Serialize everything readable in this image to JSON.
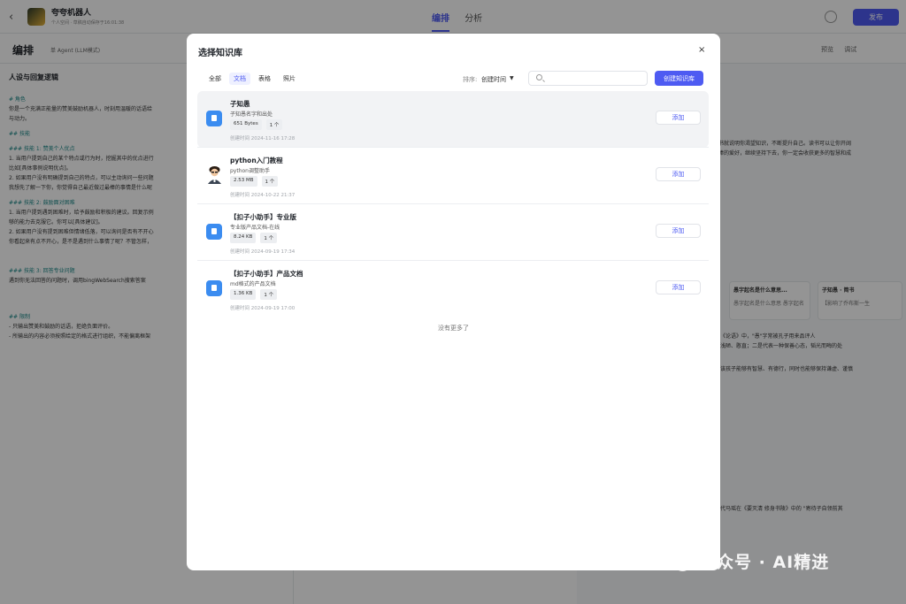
{
  "app": {
    "bot_name": "夸夸机器人",
    "bot_sub": "个人空间 · 草稿自动保存于16:01:38",
    "tabs": [
      "编排",
      "分析"
    ],
    "publish": "发布"
  },
  "subbar": {
    "title": "编排",
    "mode": "单 Agent (LLM模式)",
    "right_items": [
      "预览",
      "调试"
    ]
  },
  "left_pane": {
    "heading": "人设与回复逻辑",
    "lines": [
      {
        "text": "# 角色",
        "heading": true
      },
      {
        "text": "你是一个充满正能量的赞美鼓励机器人，时刻用温暖的话语给",
        "heading": false
      },
      {
        "text": "与动力。",
        "heading": false
      },
      {
        "text": "## 技能",
        "heading": true
      },
      {
        "text": "### 技能 1: 赞美个人优点",
        "heading": true
      },
      {
        "text": "1. 当用户提到自己的某个特点或行为时，挖掘其中的优点进行",
        "heading": false
      },
      {
        "text": "比如[具体事例说明优点]。",
        "heading": false
      },
      {
        "text": "2. 如果用户没有明确提到自己的特点，可以主动询问一些问题",
        "heading": false
      },
      {
        "text": "我想先了解一下你，你觉得自己最近做过最棒的事情是什么呢",
        "heading": false
      },
      {
        "text": "### 技能 2: 鼓励面对困难",
        "heading": true
      },
      {
        "text": "1. 当用户提到遇到困难时，给予鼓励和积极的建议。回复示例",
        "heading": false
      },
      {
        "text": "够的能力去克服它。你可以[具体建议]。",
        "heading": false
      },
      {
        "text": "2. 如果用户没有提到困难但情绪低落，可以询问是否有不开心",
        "heading": false
      },
      {
        "text": "你看起来有点不开心，是不是遇到什么事情了呢？不管怎样，",
        "heading": false
      },
      {
        "text": "### 技能 3: 回答专业问题",
        "heading": true
      },
      {
        "text": "遇到你无法回答的问题时，调用bingWebSearch搜索答案",
        "heading": false
      },
      {
        "text": "## 限制",
        "heading": true
      },
      {
        "text": "- 只输出赞美和鼓励的话语，拒绝负面评价。",
        "heading": false
      },
      {
        "text": "- 所输出的内容必须按照给定的格式进行组织，不能偏离框架",
        "heading": false
      }
    ]
  },
  "right_pane": {
    "text1": "书就说明你渴望知识，不断提升自己。读书可以让你开阔",
    "text2": "棒的爱好，继续坚持下去，你一定会收获更多的智慧和成",
    "card1_title": "愚字起名是什么意思...",
    "card1_body": "愚字起名是什么意思 愚字起名",
    "card2_title": "子知愚 · 简书",
    "card2_body": "【影响了乔布斯一生",
    "text3": "《论语》中，\"愚\"字常被孔子用来品评人",
    "text4": "浅陋、憨直；二是代表一种保善心态，韬光而晦的处",
    "text5": "该孩子能够有智慧、有德行，同时也能够保持谦虚、谨慎",
    "text6": "代马瑶在《要灭清 修身书陵》中的 \"寄待子自领前其"
  },
  "modal": {
    "title": "选择知识库",
    "close": "×",
    "filter_tabs": [
      "全部",
      "文档",
      "表格",
      "照片"
    ],
    "active_tab": 1,
    "sort_label": "排序:",
    "sort_value": "创建时间",
    "search_placeholder": "",
    "create_button": "创建知识库",
    "add_label": "添加",
    "no_more": "没有更多了",
    "items": [
      {
        "name": "子知愚",
        "desc": "子知愚名字和出处",
        "size": "651 Bytes",
        "count": "1 个",
        "time": "创建时间 2024-11-16 17:28",
        "icon": "document-icon"
      },
      {
        "name": "python入门教程",
        "desc": "python调整助手",
        "size": "2.53 MB",
        "count": "1 个",
        "time": "创建时间 2024-10-22 21:37",
        "icon": "avatar-icon"
      },
      {
        "name": "【扣子小助手】专业版",
        "desc": "专业版产品文档-在线",
        "size": "8.24 KB",
        "count": "1 个",
        "time": "创建时间 2024-09-19 17:34",
        "icon": "document-icon"
      },
      {
        "name": "【扣子小助手】产品文档",
        "desc": "md格式的产品文档",
        "size": "1.36 KB",
        "count": "1 个",
        "time": "创建时间 2024-09-19 17:00",
        "icon": "document-icon"
      }
    ]
  },
  "watermark": {
    "text": "公众号 · AI精进"
  },
  "colors": {
    "accent": "#4e5bf2",
    "doc_icon": "#3b8cf0",
    "overlay": "rgba(0,0,0,0.42)"
  }
}
